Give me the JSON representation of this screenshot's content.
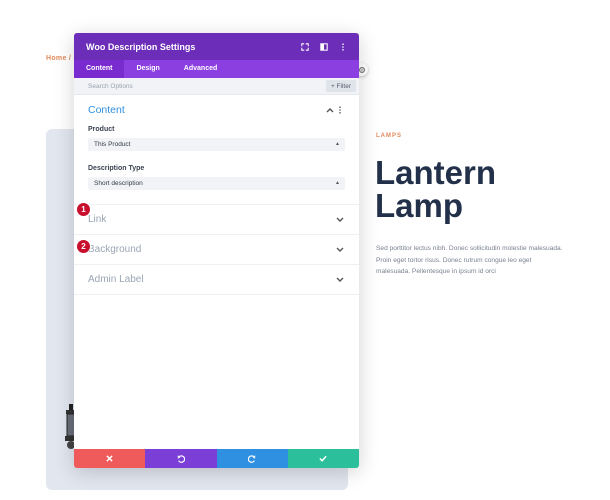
{
  "background": {
    "breadcrumb": "Home /",
    "category": "LAMPS",
    "product_title": "Lantern Lamp",
    "product_description": "Sed porttitor lectus nibh. Donec sollicitudin molestie malesuada. Proin eget tortor risus. Donec rutrum congue leo eget malesuada. Pellentesque in ipsum id orci"
  },
  "modal": {
    "title": "Woo Description Settings",
    "header_icons": [
      "expand-icon",
      "split-view-icon",
      "more-options-icon"
    ],
    "tabs": [
      {
        "label": "Content",
        "active": true
      },
      {
        "label": "Design",
        "active": false
      },
      {
        "label": "Advanced",
        "active": false
      }
    ],
    "search": {
      "placeholder": "Search Options",
      "filter_label": "+ Filter"
    },
    "content_section": {
      "title": "Content",
      "fields": [
        {
          "label": "Product",
          "value": "This Product",
          "badge": "1"
        },
        {
          "label": "Description Type",
          "value": "Short description",
          "badge": "2"
        }
      ]
    },
    "collapsed_sections": [
      "Link",
      "Background",
      "Admin Label"
    ],
    "footer": [
      "cancel-icon",
      "undo-icon",
      "redo-icon",
      "save-icon"
    ]
  },
  "colors": {
    "header": "#6c2eb9",
    "tabs": "#8b3fe0",
    "accent_blue": "#2f8fe0",
    "cancel": "#ef5a5a",
    "undo": "#7b3fd8",
    "redo": "#2f8fe0",
    "save": "#2bbf9c",
    "badge": "#c8102e"
  }
}
